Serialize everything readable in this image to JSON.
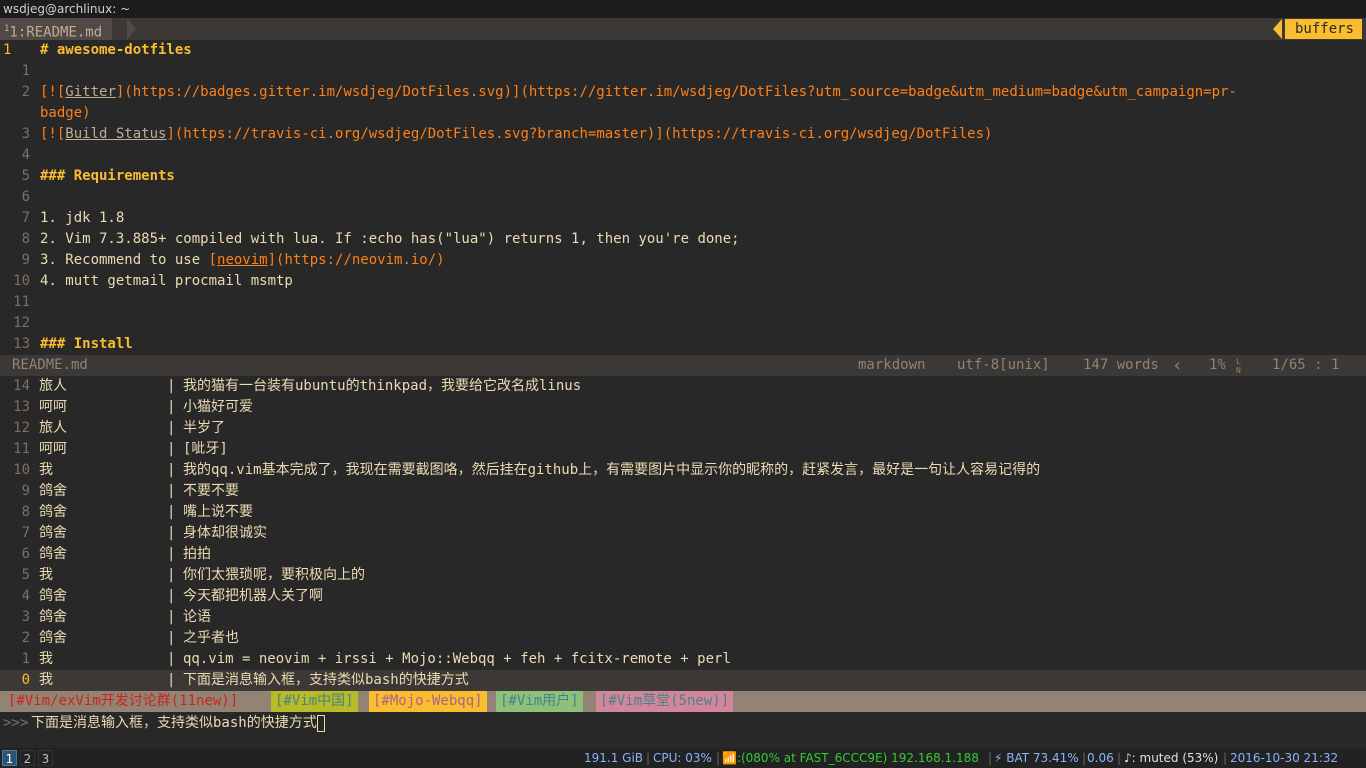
{
  "window": {
    "title": "wsdjeg@archlinux: ~"
  },
  "tabline": {
    "tab_num": "1",
    "tab_label": "1:README.md",
    "buffers_label": "buffers"
  },
  "editor": {
    "lines": [
      {
        "n": "1",
        "t": "# awesome-dotfiles"
      },
      {
        "n": "1",
        "t": ""
      },
      {
        "n": "2",
        "t": "[![Gitter](https://badges.gitter.im/wsdjeg/DotFiles.svg)](https://gitter.im/wsdjeg/DotFiles?utm_source=badge&utm_medium=badge&utm_campaign=pr-"
      },
      {
        "n": "",
        "t": "badge)"
      },
      {
        "n": "3",
        "t": "[![Build Status](https://travis-ci.org/wsdjeg/DotFiles.svg?branch=master)](https://travis-ci.org/wsdjeg/DotFiles)"
      },
      {
        "n": "4",
        "t": ""
      },
      {
        "n": "5",
        "t": "### Requirements"
      },
      {
        "n": "6",
        "t": ""
      },
      {
        "n": "7",
        "t": "1. jdk 1.8"
      },
      {
        "n": "8",
        "t": "2. Vim 7.3.885+ compiled with lua. If :echo has(\"lua\") returns 1, then you're done;"
      },
      {
        "n": "9",
        "t": "3. Recommend to use [neovim](https://neovim.io/)"
      },
      {
        "n": "10",
        "t": "4. mutt getmail procmail msmtp"
      },
      {
        "n": "11",
        "t": ""
      },
      {
        "n": "12",
        "t": ""
      },
      {
        "n": "13",
        "t": "### Install"
      }
    ],
    "parts": {
      "h1": "# awesome-dotfiles",
      "l2a": "[![",
      "l2b": "Gitter",
      "l2c": "](https://badges.gitter.im/wsdjeg/DotFiles.svg)](https://gitter.im/wsdjeg/DotFiles?utm_source=badge&utm_medium=badge&utm_campaign=pr-",
      "l2d": "badge)",
      "l3a": "[![",
      "l3b": "Build Status",
      "l3c": "](https://travis-ci.org/wsdjeg/DotFiles.svg?branch=master)](https://travis-ci.org/wsdjeg/DotFiles)",
      "h3a": "### Requirements",
      "req1": "1. jdk 1.8",
      "req2": "2. Vim 7.3.885+ compiled with lua. If :echo has(\"lua\") returns 1, then you're done;",
      "req3a": "3. Recommend to use ",
      "req3b": "[",
      "req3c": "neovim",
      "req3d": "](https://neovim.io/)",
      "req4": "4. mutt getmail procmail msmtp",
      "h3b": "### Install"
    }
  },
  "statusline": {
    "filename": "README.md",
    "filetype": "markdown",
    "encoding": "utf-8[unix]",
    "words": "147 words",
    "percent": "1%",
    "ln_icon": "L N",
    "position": "1/65 :  1"
  },
  "chat": [
    {
      "n": "14",
      "name": "旅人",
      "msg": "我的猫有一台装有ubuntu的thinkpad，我要给它改名成linus"
    },
    {
      "n": "13",
      "name": "呵呵",
      "msg": "小猫好可爱"
    },
    {
      "n": "12",
      "name": "旅人",
      "msg": "半岁了"
    },
    {
      "n": "11",
      "name": "呵呵",
      "msg": "[呲牙]"
    },
    {
      "n": "10",
      "name": "我",
      "msg": "我的qq.vim基本完成了，我现在需要截图咯，然后挂在github上，有需要图片中显示你的昵称的，赶紧发言，最好是一句让人容易记得的"
    },
    {
      "n": "9",
      "name": "鸽舍",
      "msg": "不要不要"
    },
    {
      "n": "8",
      "name": "鸽舍",
      "msg": "嘴上说不要"
    },
    {
      "n": "7",
      "name": "鸽舍",
      "msg": "身体却很诚实"
    },
    {
      "n": "6",
      "name": "鸽舍",
      "msg": "拍拍"
    },
    {
      "n": "5",
      "name": "我",
      "msg": "你们太猥琐呢，要积极向上的"
    },
    {
      "n": "4",
      "name": "鸽舍",
      "msg": "今天都把机器人关了啊"
    },
    {
      "n": "3",
      "name": "鸽舍",
      "msg": "论语"
    },
    {
      "n": "2",
      "name": "鸽舍",
      "msg": "之乎者也"
    },
    {
      "n": "1",
      "name": "我",
      "msg": "qq.vim = neovim + irssi + Mojo::Webqq + feh + fcitx-remote + perl"
    },
    {
      "n": "0",
      "name": "我",
      "msg": "下面是消息输入框，支持类似bash的快捷方式"
    }
  ],
  "chat_separator": "|",
  "channels": [
    {
      "label": "[#Vim/exVim开发讨论群(11new)]",
      "bg": "#928374",
      "fg": "#cc241d"
    },
    {
      "label": "[#Vim中国]",
      "bg": "#b8bb26",
      "fg": "#458588"
    },
    {
      "label": "[#Mojo-Webqq]",
      "bg": "#fabd2f",
      "fg": "#b16286"
    },
    {
      "label": "[#Vim用户]",
      "bg": "#8ec07c",
      "fg": "#458588"
    },
    {
      "label": "[#Vim草堂(5new)]",
      "bg": "#d3869b",
      "fg": "#458588"
    }
  ],
  "input": {
    "prompt": ">>>",
    "text": "下面是消息输入框，支持类似bash的快捷方式"
  },
  "bottombar": {
    "workspaces": [
      "1",
      "2",
      "3"
    ],
    "disk": "191.1 GiB",
    "cpu": "CPU: 03%",
    "wifi": "📶:(080% at FAST_6CCC9E) 192.168.1.188",
    "bat": "⚡ BAT 73.41%",
    "load": "0.06",
    "vol": "♪: muted (53%)",
    "datetime": "2016-10-30 21:32",
    "sep": "|"
  },
  "colors": {
    "bg": "#282828",
    "accent": "#fabd2f",
    "orange": "#fe8019",
    "blue": "#83a598"
  }
}
